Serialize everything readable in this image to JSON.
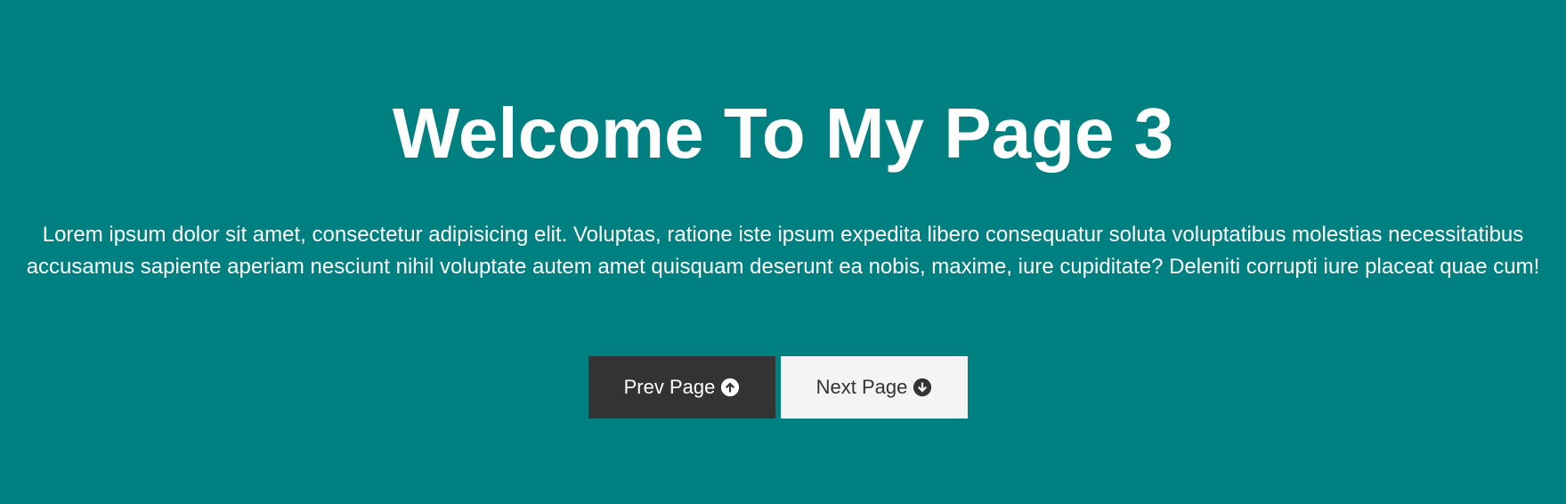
{
  "header": {
    "title": "Welcome To My Page 3"
  },
  "main": {
    "intro_text": "Lorem ipsum dolor sit amet, consectetur adipisicing elit. Voluptas, ratione iste ipsum expedita libero consequatur soluta voluptatibus molestias necessitatibus accusamus sapiente aperiam nesciunt nihil voluptate autem amet quisquam deserunt ea nobis, maxime, iure cupiditate? Deleniti corrupti iure placeat quae cum!"
  },
  "navigation": {
    "prev_label": "Prev Page",
    "prev_icon": "arrow-circle-up-icon",
    "next_label": "Next Page",
    "next_icon": "arrow-circle-down-icon"
  },
  "colors": {
    "background": "#008080",
    "prev_button_bg": "#333333",
    "next_button_bg": "#f4f4f4",
    "text": "#ffffff"
  }
}
